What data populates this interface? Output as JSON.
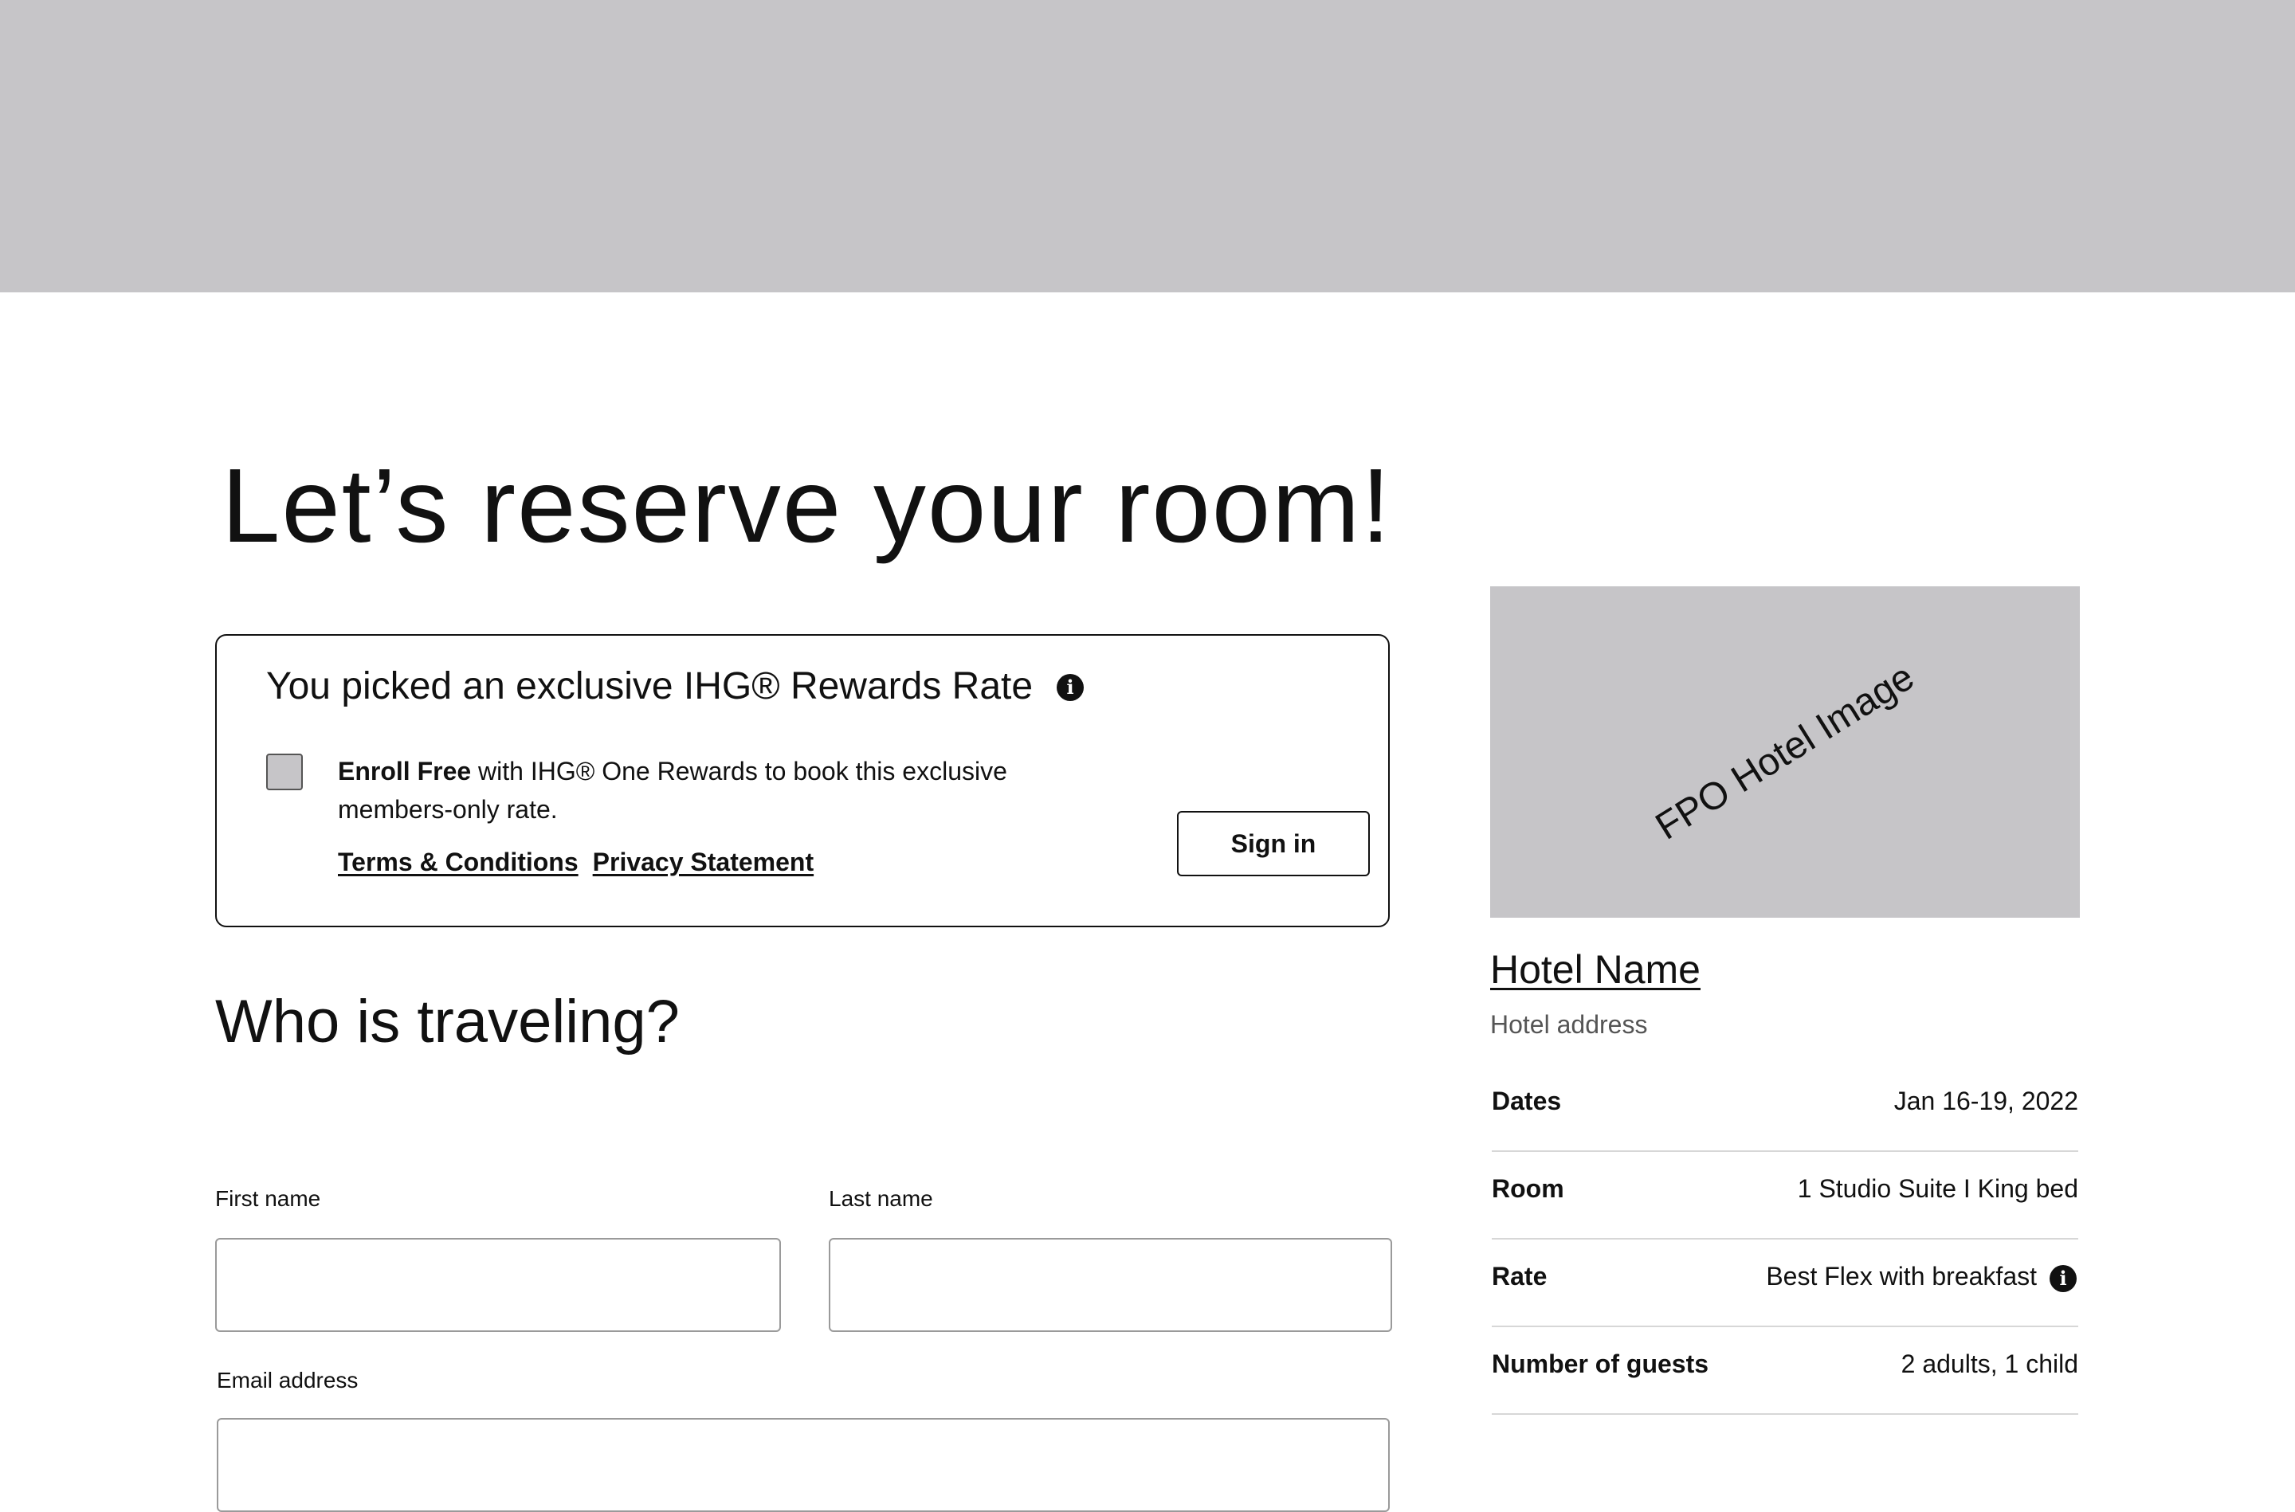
{
  "page": {
    "title": "Let’s reserve your room!"
  },
  "rewards": {
    "title": "You picked an exclusive IHG® Rewards Rate",
    "enroll_bold": "Enroll Free",
    "enroll_text": " with IHG® One Rewards to book this exclusive members-only rate.",
    "terms_link": "Terms & Conditions",
    "privacy_link": "Privacy Statement",
    "sign_in_label": "Sign in",
    "info_icon": "info-icon"
  },
  "travelers": {
    "heading": "Who is traveling?",
    "first_name_label": "First name",
    "first_name_value": "",
    "last_name_label": "Last name",
    "last_name_value": "",
    "email_label": "Email address",
    "email_value": ""
  },
  "hotel": {
    "image_caption": "FPO Hotel Image",
    "name": "Hotel Name",
    "address": "Hotel address"
  },
  "summary": {
    "rows": [
      {
        "label": "Dates",
        "value": "Jan 16-19, 2022"
      },
      {
        "label": "Room",
        "value": "1 Studio Suite I King bed"
      },
      {
        "label": "Rate",
        "value": "Best Flex with breakfast",
        "icon": "info-icon"
      },
      {
        "label": "Number of guests",
        "value": "2 adults, 1 child"
      }
    ]
  },
  "colors": {
    "banner_gray": "#c6c5c8",
    "text": "#111111",
    "muted_text": "#555555",
    "divider": "#d7d7d7"
  }
}
